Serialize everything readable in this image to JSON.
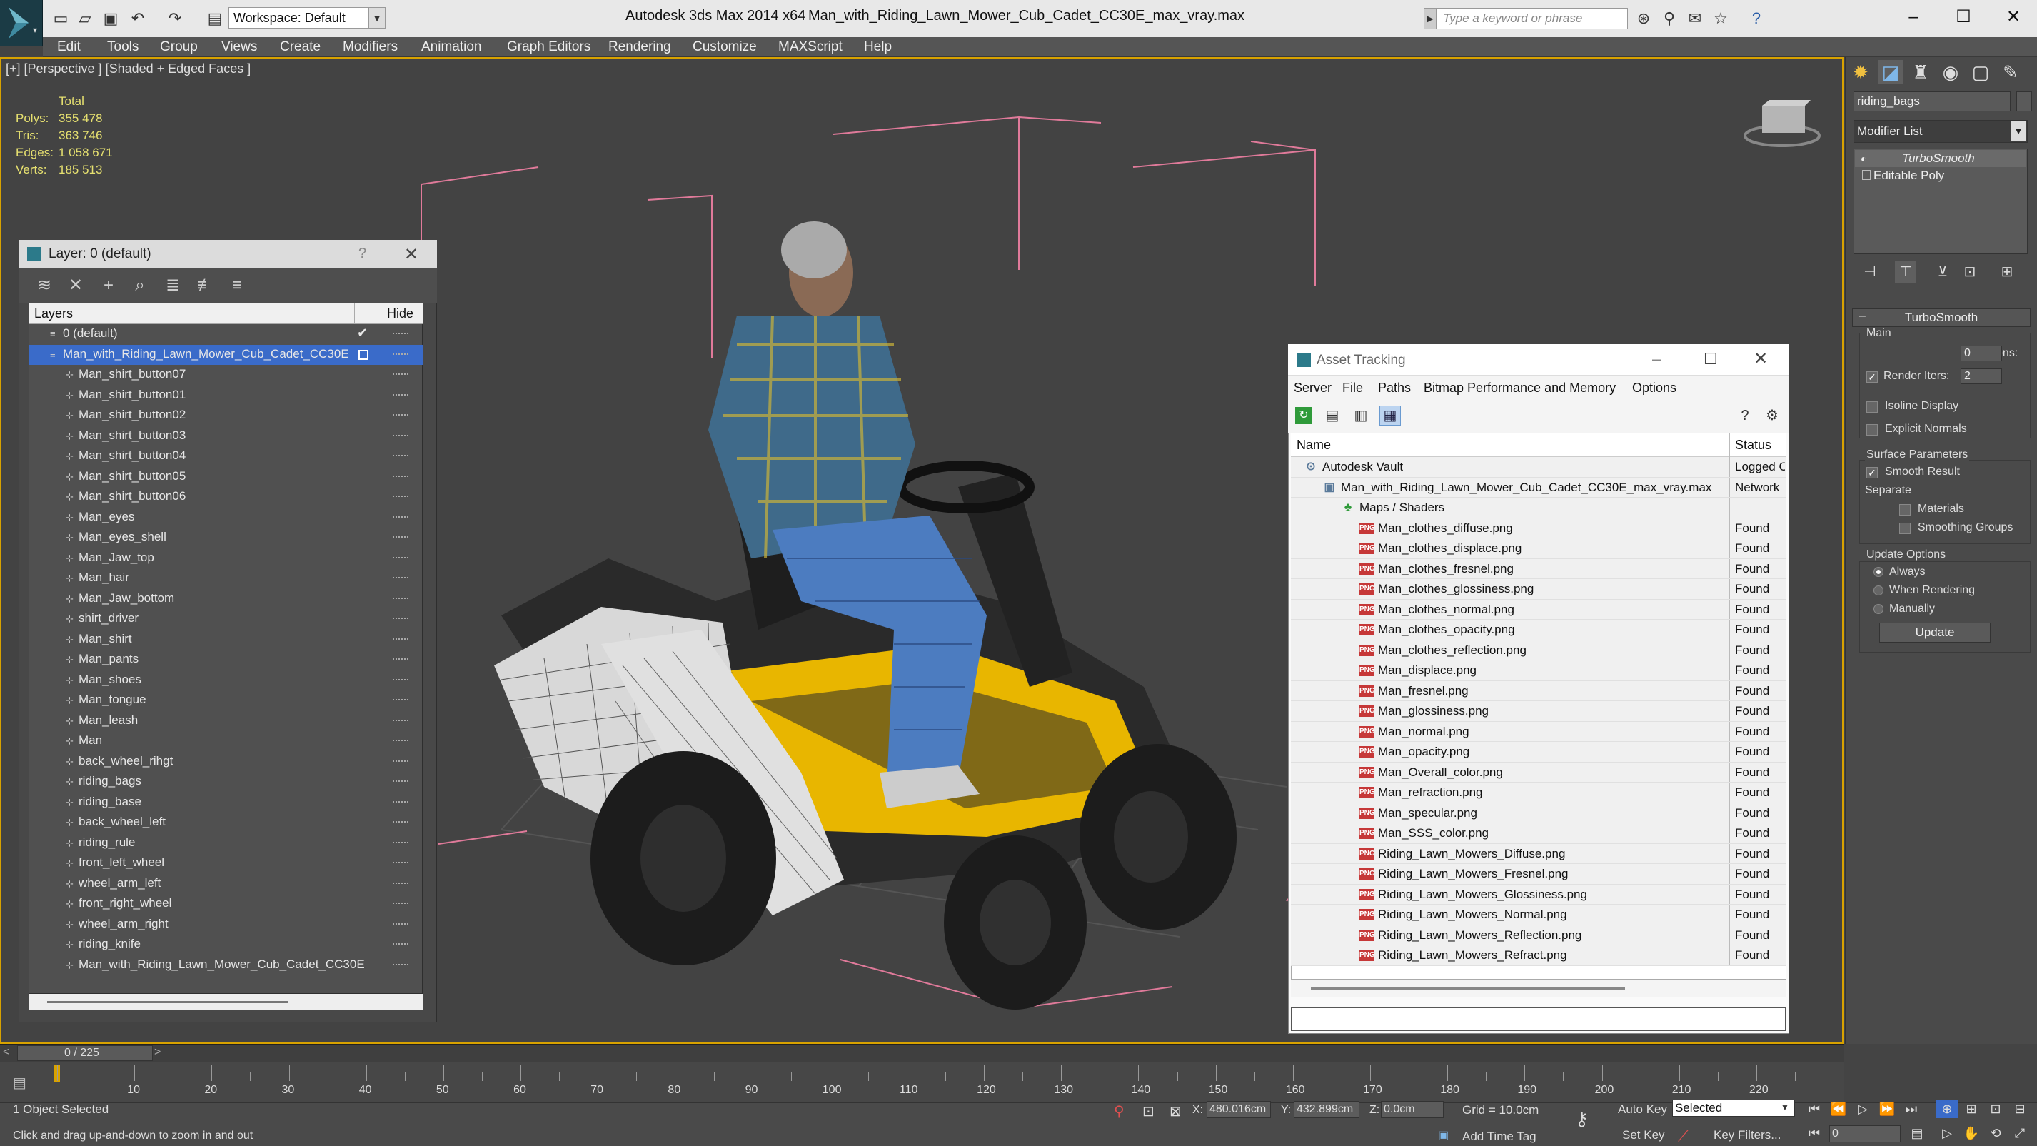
{
  "titlebar": {
    "workspace": "Workspace: Default",
    "app_title": "Autodesk 3ds Max  2014 x64",
    "file_title": "Man_with_Riding_Lawn_Mower_Cub_Cadet_CC30E_max_vray.max",
    "search_placeholder": "Type a keyword or phrase"
  },
  "menu": [
    "Edit",
    "Tools",
    "Group",
    "Views",
    "Create",
    "Modifiers",
    "Animation",
    "Graph Editors",
    "Rendering",
    "Customize",
    "MAXScript",
    "Help"
  ],
  "viewport": {
    "label": "[+] [Perspective ] [Shaded + Edged Faces ]",
    "stats_header": "Total",
    "stats": [
      {
        "label": "Polys:",
        "value": "355 478"
      },
      {
        "label": "Tris:",
        "value": "363 746"
      },
      {
        "label": "Edges:",
        "value": "1 058 671"
      },
      {
        "label": "Verts:",
        "value": "185 513"
      }
    ]
  },
  "layer_dialog": {
    "title": "Layer: 0 (default)",
    "help": "?",
    "col_layers": "Layers",
    "col_hide": "Hide",
    "rows": [
      {
        "name": "0 (default)",
        "level": 0,
        "selected": false,
        "check": true
      },
      {
        "name": "Man_with_Riding_Lawn_Mower_Cub_Cadet_CC30E",
        "level": 0,
        "selected": true,
        "check": false
      },
      {
        "name": "Man_shirt_button07",
        "level": 1
      },
      {
        "name": "Man_shirt_button01",
        "level": 1
      },
      {
        "name": "Man_shirt_button02",
        "level": 1
      },
      {
        "name": "Man_shirt_button03",
        "level": 1
      },
      {
        "name": "Man_shirt_button04",
        "level": 1
      },
      {
        "name": "Man_shirt_button05",
        "level": 1
      },
      {
        "name": "Man_shirt_button06",
        "level": 1
      },
      {
        "name": "Man_eyes",
        "level": 1
      },
      {
        "name": "Man_eyes_shell",
        "level": 1
      },
      {
        "name": "Man_Jaw_top",
        "level": 1
      },
      {
        "name": "Man_hair",
        "level": 1
      },
      {
        "name": "Man_Jaw_bottom",
        "level": 1
      },
      {
        "name": "shirt_driver",
        "level": 1
      },
      {
        "name": "Man_shirt",
        "level": 1
      },
      {
        "name": "Man_pants",
        "level": 1
      },
      {
        "name": "Man_shoes",
        "level": 1
      },
      {
        "name": "Man_tongue",
        "level": 1
      },
      {
        "name": "Man_leash",
        "level": 1
      },
      {
        "name": "Man",
        "level": 1
      },
      {
        "name": "back_wheel_rihgt",
        "level": 1
      },
      {
        "name": "riding_bags",
        "level": 1
      },
      {
        "name": "riding_base",
        "level": 1
      },
      {
        "name": "back_wheel_left",
        "level": 1
      },
      {
        "name": "riding_rule",
        "level": 1
      },
      {
        "name": "front_left_wheel",
        "level": 1
      },
      {
        "name": "wheel_arm_left",
        "level": 1
      },
      {
        "name": "front_right_wheel",
        "level": 1
      },
      {
        "name": "wheel_arm_right",
        "level": 1
      },
      {
        "name": "riding_knife",
        "level": 1
      },
      {
        "name": "Man_with_Riding_Lawn_Mower_Cub_Cadet_CC30E",
        "level": 1
      }
    ]
  },
  "asset_tracking": {
    "title": "Asset Tracking",
    "menu": [
      "Server",
      "File",
      "Paths",
      "Bitmap Performance and Memory",
      "Options"
    ],
    "col_name": "Name",
    "col_status": "Status",
    "rows": [
      {
        "name": "Autodesk Vault",
        "status": "Logged O",
        "level": 0,
        "icon": "vault"
      },
      {
        "name": "Man_with_Riding_Lawn_Mower_Cub_Cadet_CC30E_max_vray.max",
        "status": "Network",
        "level": 1,
        "icon": "file"
      },
      {
        "name": "Maps / Shaders",
        "status": "",
        "level": 2,
        "icon": "maps"
      },
      {
        "name": "Man_clothes_diffuse.png",
        "status": "Found",
        "level": 3,
        "icon": "png"
      },
      {
        "name": "Man_clothes_displace.png",
        "status": "Found",
        "level": 3,
        "icon": "png"
      },
      {
        "name": "Man_clothes_fresnel.png",
        "status": "Found",
        "level": 3,
        "icon": "png"
      },
      {
        "name": "Man_clothes_glossiness.png",
        "status": "Found",
        "level": 3,
        "icon": "png"
      },
      {
        "name": "Man_clothes_normal.png",
        "status": "Found",
        "level": 3,
        "icon": "png"
      },
      {
        "name": "Man_clothes_opacity.png",
        "status": "Found",
        "level": 3,
        "icon": "png"
      },
      {
        "name": "Man_clothes_reflection.png",
        "status": "Found",
        "level": 3,
        "icon": "png"
      },
      {
        "name": "Man_displace.png",
        "status": "Found",
        "level": 3,
        "icon": "png"
      },
      {
        "name": "Man_fresnel.png",
        "status": "Found",
        "level": 3,
        "icon": "png"
      },
      {
        "name": "Man_glossiness.png",
        "status": "Found",
        "level": 3,
        "icon": "png"
      },
      {
        "name": "Man_normal.png",
        "status": "Found",
        "level": 3,
        "icon": "png"
      },
      {
        "name": "Man_opacity.png",
        "status": "Found",
        "level": 3,
        "icon": "png"
      },
      {
        "name": "Man_Overall_color.png",
        "status": "Found",
        "level": 3,
        "icon": "png"
      },
      {
        "name": "Man_refraction.png",
        "status": "Found",
        "level": 3,
        "icon": "png"
      },
      {
        "name": "Man_specular.png",
        "status": "Found",
        "level": 3,
        "icon": "png"
      },
      {
        "name": "Man_SSS_color.png",
        "status": "Found",
        "level": 3,
        "icon": "png"
      },
      {
        "name": "Riding_Lawn_Mowers_Diffuse.png",
        "status": "Found",
        "level": 3,
        "icon": "png"
      },
      {
        "name": "Riding_Lawn_Mowers_Fresnel.png",
        "status": "Found",
        "level": 3,
        "icon": "png"
      },
      {
        "name": "Riding_Lawn_Mowers_Glossiness.png",
        "status": "Found",
        "level": 3,
        "icon": "png"
      },
      {
        "name": "Riding_Lawn_Mowers_Normal.png",
        "status": "Found",
        "level": 3,
        "icon": "png"
      },
      {
        "name": "Riding_Lawn_Mowers_Reflection.png",
        "status": "Found",
        "level": 3,
        "icon": "png"
      },
      {
        "name": "Riding_Lawn_Mowers_Refract.png",
        "status": "Found",
        "level": 3,
        "icon": "png"
      }
    ]
  },
  "command_panel": {
    "object_name": "riding_bags",
    "modifier_list": "Modifier List",
    "stack": [
      "TurboSmooth",
      "Editable Poly"
    ],
    "rollout_title": "TurboSmooth",
    "main_group": "Main",
    "iterations_label": "Iterations:",
    "iterations_value": "0",
    "render_iters_label": "Render Iters:",
    "render_iters_value": "2",
    "render_iters_checked": true,
    "isoline_label": "Isoline Display",
    "explicit_normals_label": "Explicit Normals",
    "surface_group": "Surface Parameters",
    "smooth_result_label": "Smooth Result",
    "separate_label": "Separate",
    "materials_label": "Materials",
    "smoothing_groups_label": "Smoothing Groups",
    "update_group": "Update Options",
    "always_label": "Always",
    "when_rendering_label": "When Rendering",
    "manually_label": "Manually",
    "update_button": "Update"
  },
  "timeline": {
    "frame_readout": "0 / 225",
    "ticks": [
      "10",
      "20",
      "30",
      "40",
      "50",
      "60",
      "70",
      "80",
      "90",
      "100",
      "110",
      "120",
      "130",
      "140",
      "150",
      "160",
      "170",
      "180",
      "190",
      "200",
      "210",
      "220"
    ]
  },
  "status": {
    "selection": "1 Object Selected",
    "prompt": "Click and drag up-and-down to zoom in and out",
    "x_label": "X:",
    "x_value": "480.016cm",
    "y_label": "Y:",
    "y_value": "432.899cm",
    "z_label": "Z:",
    "z_value": "0.0cm",
    "grid": "Grid = 10.0cm",
    "auto_key": "Auto Key",
    "set_key": "Set Key",
    "selected_dropdown": "Selected",
    "key_filters": "Key Filters...",
    "add_time_tag": "Add Time Tag",
    "frame_value": "0"
  },
  "colors": {
    "viewport_border": "#d8a200",
    "selection": "#3a6bc9",
    "mower_yellow": "#e8b600"
  }
}
